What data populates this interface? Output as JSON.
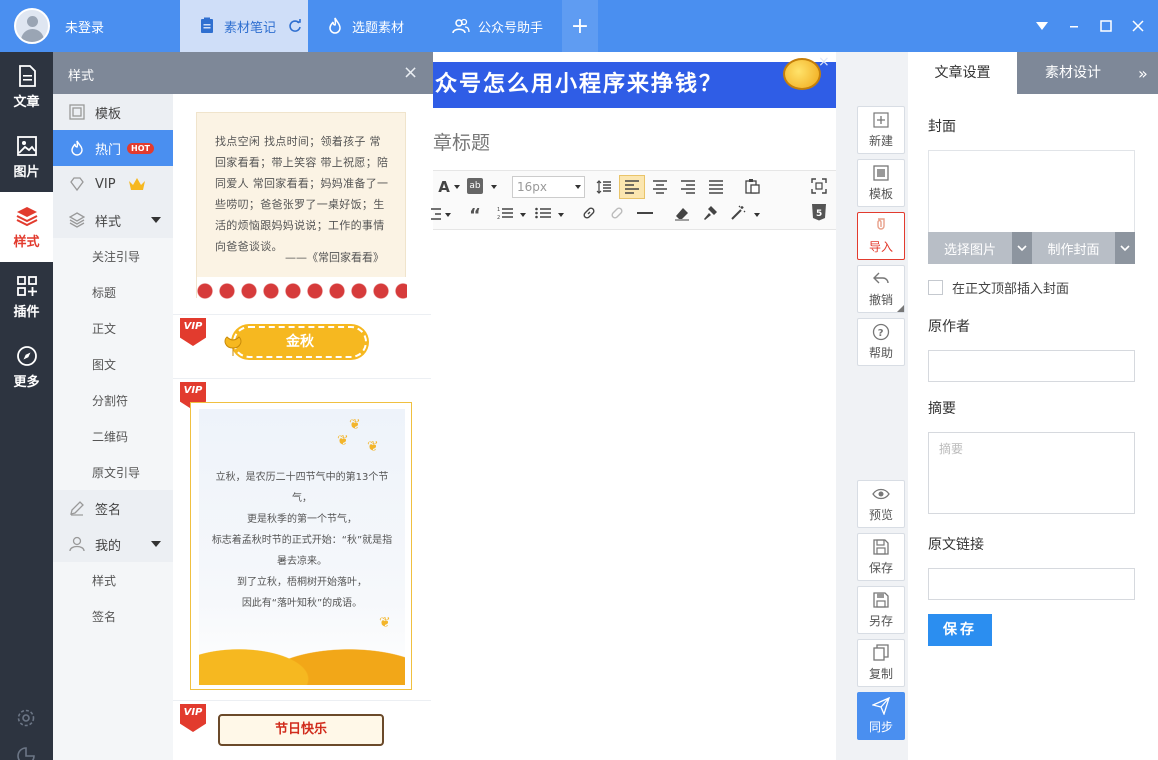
{
  "app": {
    "login_status": "未登录",
    "tabs": [
      {
        "label": "素材笔记",
        "active": true
      },
      {
        "label": "选题素材",
        "active": false
      },
      {
        "label": "公众号助手",
        "active": false
      }
    ],
    "add_tab_label": "+"
  },
  "sidebar": {
    "items": [
      {
        "label": "文章",
        "icon": "document-icon"
      },
      {
        "label": "图片",
        "icon": "image-icon"
      },
      {
        "label": "样式",
        "icon": "layers-icon",
        "active": true
      },
      {
        "label": "插件",
        "icon": "plugins-icon"
      },
      {
        "label": "更多",
        "icon": "compass-icon"
      }
    ]
  },
  "style_panel": {
    "title": "样式",
    "close_glyph": "×",
    "categories": [
      {
        "label": "模板",
        "icon": "template-icon"
      },
      {
        "label": "热门",
        "icon": "flame-icon",
        "badge": "HOT",
        "active": true
      },
      {
        "label": "VIP",
        "icon": "diamond-icon",
        "crown": true
      },
      {
        "label": "样式",
        "icon": "layers-icon",
        "expandable": true
      },
      {
        "label": "关注引导"
      },
      {
        "label": "标题"
      },
      {
        "label": "正文"
      },
      {
        "label": "图文"
      },
      {
        "label": "分割符"
      },
      {
        "label": "二维码"
      },
      {
        "label": "原文引导"
      },
      {
        "label": "签名",
        "icon": "pen-icon"
      },
      {
        "label": "我的",
        "icon": "user-icon",
        "expandable": true
      },
      {
        "label": "样式"
      },
      {
        "label": "签名"
      }
    ],
    "cards": {
      "poem_text": "找点空闲 找点时间；领着孩子 常回家看看；带上笑容 带上祝愿；陪同爱人 常回家看看；妈妈准备了一些唠叨；爸爸张罗了一桌好饭；生活的烦恼跟妈妈说说；工作的事情向爸爸谈谈。",
      "poem_signature": "——《常回家看看》",
      "vip_label": "VIP",
      "autumn_banner": "金秋",
      "autumn_lines": [
        "立秋，是农历二十四节气中的第13个节气，",
        "更是秋季的第一个节气，",
        "标志着孟秋时节的正式开始：“秋”就是指暑去凉来。",
        "到了立秋，梧桐树开始落叶，",
        "因此有“落叶知秋”的成语。"
      ],
      "festival_banner": "节日快乐"
    }
  },
  "editor": {
    "ad_text": "众号怎么用小程序来挣钱？",
    "title_placeholder": "章标题",
    "font_size": "16px"
  },
  "actions": [
    {
      "label": "新建",
      "icon": "plus-icon"
    },
    {
      "label": "模板",
      "icon": "template-icon"
    },
    {
      "label": "导入",
      "icon": "import-icon",
      "highlight": true
    },
    {
      "label": "撤销",
      "icon": "undo-icon"
    },
    {
      "label": "帮助",
      "icon": "help-icon"
    },
    {
      "label": "预览",
      "icon": "eye-icon"
    },
    {
      "label": "保存",
      "icon": "save-icon"
    },
    {
      "label": "另存",
      "icon": "save-as-icon"
    },
    {
      "label": "复制",
      "icon": "copy-icon"
    },
    {
      "label": "同步",
      "icon": "send-icon",
      "primary": true
    }
  ],
  "settings": {
    "tabs": [
      "文章设置",
      "素材设计"
    ],
    "cover_label": "封面",
    "choose_image": "选择图片",
    "make_cover": "制作封面",
    "insert_cover_label": "在正文顶部插入封面",
    "author_label": "原作者",
    "summary_label": "摘要",
    "summary_placeholder": "摘要",
    "link_label": "原文链接",
    "save_label": "保存"
  },
  "colors": {
    "topbar": "#4a8ff0",
    "sidebar": "#2d3440",
    "active_accent": "#e23b2e",
    "primary": "#2b8ef0"
  }
}
